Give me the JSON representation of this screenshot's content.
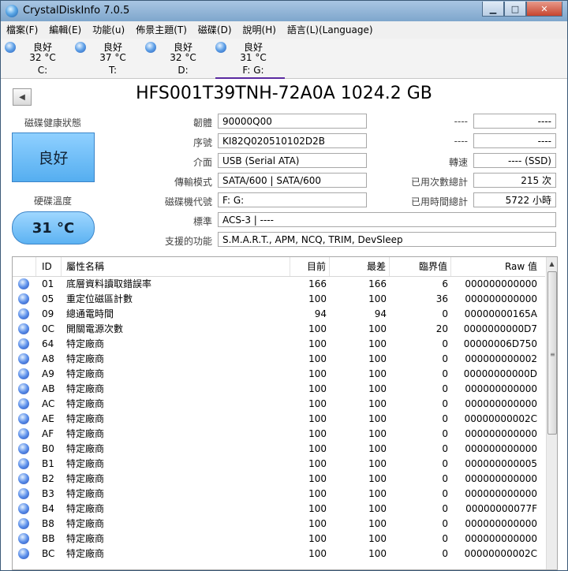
{
  "window": {
    "title": "CrystalDiskInfo 7.0.5",
    "min_glyph": "▁",
    "max_glyph": "□",
    "close_glyph": "✕"
  },
  "menu": [
    "檔案(F)",
    "編輯(E)",
    "功能(u)",
    "佈景主題(T)",
    "磁碟(D)",
    "說明(H)",
    "語言(L)(Language)"
  ],
  "drives": [
    {
      "status": "良好",
      "temp": "32 °C",
      "letter": "C:"
    },
    {
      "status": "良好",
      "temp": "37 °C",
      "letter": "T:"
    },
    {
      "status": "良好",
      "temp": "32 °C",
      "letter": "D:"
    },
    {
      "status": "良好",
      "temp": "31 °C",
      "letter": "F: G:"
    }
  ],
  "nav_prev": "◀",
  "disk": {
    "model": "HFS001T39TNH-72A0A 1024.2 GB",
    "health_label": "磁碟健康狀態",
    "health_value": "良好",
    "temp_label": "硬碟溫度",
    "temp_value": "31 °C",
    "fields": {
      "firmware_label": "韌體",
      "firmware": "90000Q00",
      "serial_label": "序號",
      "serial": "KI82Q020510102D2B",
      "interface_label": "介面",
      "interface": "USB (Serial ATA)",
      "transfer_label": "傳輸模式",
      "transfer": "SATA/600 | SATA/600",
      "letter_label": "磁碟機代號",
      "letter": "F: G:",
      "standard_label": "標準",
      "standard": "ACS-3 | ----",
      "features_label": "支援的功能",
      "features": "S.M.A.R.T., APM, NCQ, TRIM, DevSleep",
      "r1_label": "----",
      "r1": "----",
      "r2_label": "----",
      "r2": "----",
      "rotation_label": "轉速",
      "rotation": "---- (SSD)",
      "power_count_label": "已用次數總計",
      "power_count": "215 次",
      "power_hours_label": "已用時間總計",
      "power_hours": "5722 小時"
    }
  },
  "table": {
    "headers": {
      "id": "ID",
      "name": "屬性名稱",
      "current": "目前",
      "worst": "最差",
      "threshold": "臨界值",
      "raw": "Raw 值"
    },
    "rows": [
      {
        "id": "01",
        "name": "底層資料讀取錯誤率",
        "current": "166",
        "worst": "166",
        "threshold": "6",
        "raw": "000000000000"
      },
      {
        "id": "05",
        "name": "重定位磁區計數",
        "current": "100",
        "worst": "100",
        "threshold": "36",
        "raw": "000000000000"
      },
      {
        "id": "09",
        "name": "總通電時間",
        "current": "94",
        "worst": "94",
        "threshold": "0",
        "raw": "00000000165A"
      },
      {
        "id": "0C",
        "name": "開關電源次數",
        "current": "100",
        "worst": "100",
        "threshold": "20",
        "raw": "0000000000D7"
      },
      {
        "id": "64",
        "name": "特定廠商",
        "current": "100",
        "worst": "100",
        "threshold": "0",
        "raw": "00000006D750"
      },
      {
        "id": "A8",
        "name": "特定廠商",
        "current": "100",
        "worst": "100",
        "threshold": "0",
        "raw": "000000000002"
      },
      {
        "id": "A9",
        "name": "特定廠商",
        "current": "100",
        "worst": "100",
        "threshold": "0",
        "raw": "00000000000D"
      },
      {
        "id": "AB",
        "name": "特定廠商",
        "current": "100",
        "worst": "100",
        "threshold": "0",
        "raw": "000000000000"
      },
      {
        "id": "AC",
        "name": "特定廠商",
        "current": "100",
        "worst": "100",
        "threshold": "0",
        "raw": "000000000000"
      },
      {
        "id": "AE",
        "name": "特定廠商",
        "current": "100",
        "worst": "100",
        "threshold": "0",
        "raw": "00000000002C"
      },
      {
        "id": "AF",
        "name": "特定廠商",
        "current": "100",
        "worst": "100",
        "threshold": "0",
        "raw": "000000000000"
      },
      {
        "id": "B0",
        "name": "特定廠商",
        "current": "100",
        "worst": "100",
        "threshold": "0",
        "raw": "000000000000"
      },
      {
        "id": "B1",
        "name": "特定廠商",
        "current": "100",
        "worst": "100",
        "threshold": "0",
        "raw": "000000000005"
      },
      {
        "id": "B2",
        "name": "特定廠商",
        "current": "100",
        "worst": "100",
        "threshold": "0",
        "raw": "000000000000"
      },
      {
        "id": "B3",
        "name": "特定廠商",
        "current": "100",
        "worst": "100",
        "threshold": "0",
        "raw": "000000000000"
      },
      {
        "id": "B4",
        "name": "特定廠商",
        "current": "100",
        "worst": "100",
        "threshold": "0",
        "raw": "00000000077F"
      },
      {
        "id": "B8",
        "name": "特定廠商",
        "current": "100",
        "worst": "100",
        "threshold": "0",
        "raw": "000000000000"
      },
      {
        "id": "BB",
        "name": "特定廠商",
        "current": "100",
        "worst": "100",
        "threshold": "0",
        "raw": "000000000000"
      },
      {
        "id": "BC",
        "name": "特定廠商",
        "current": "100",
        "worst": "100",
        "threshold": "0",
        "raw": "00000000002C"
      }
    ]
  },
  "scrollbar": {
    "up_glyph": "▲",
    "grip_glyph": "≡"
  }
}
